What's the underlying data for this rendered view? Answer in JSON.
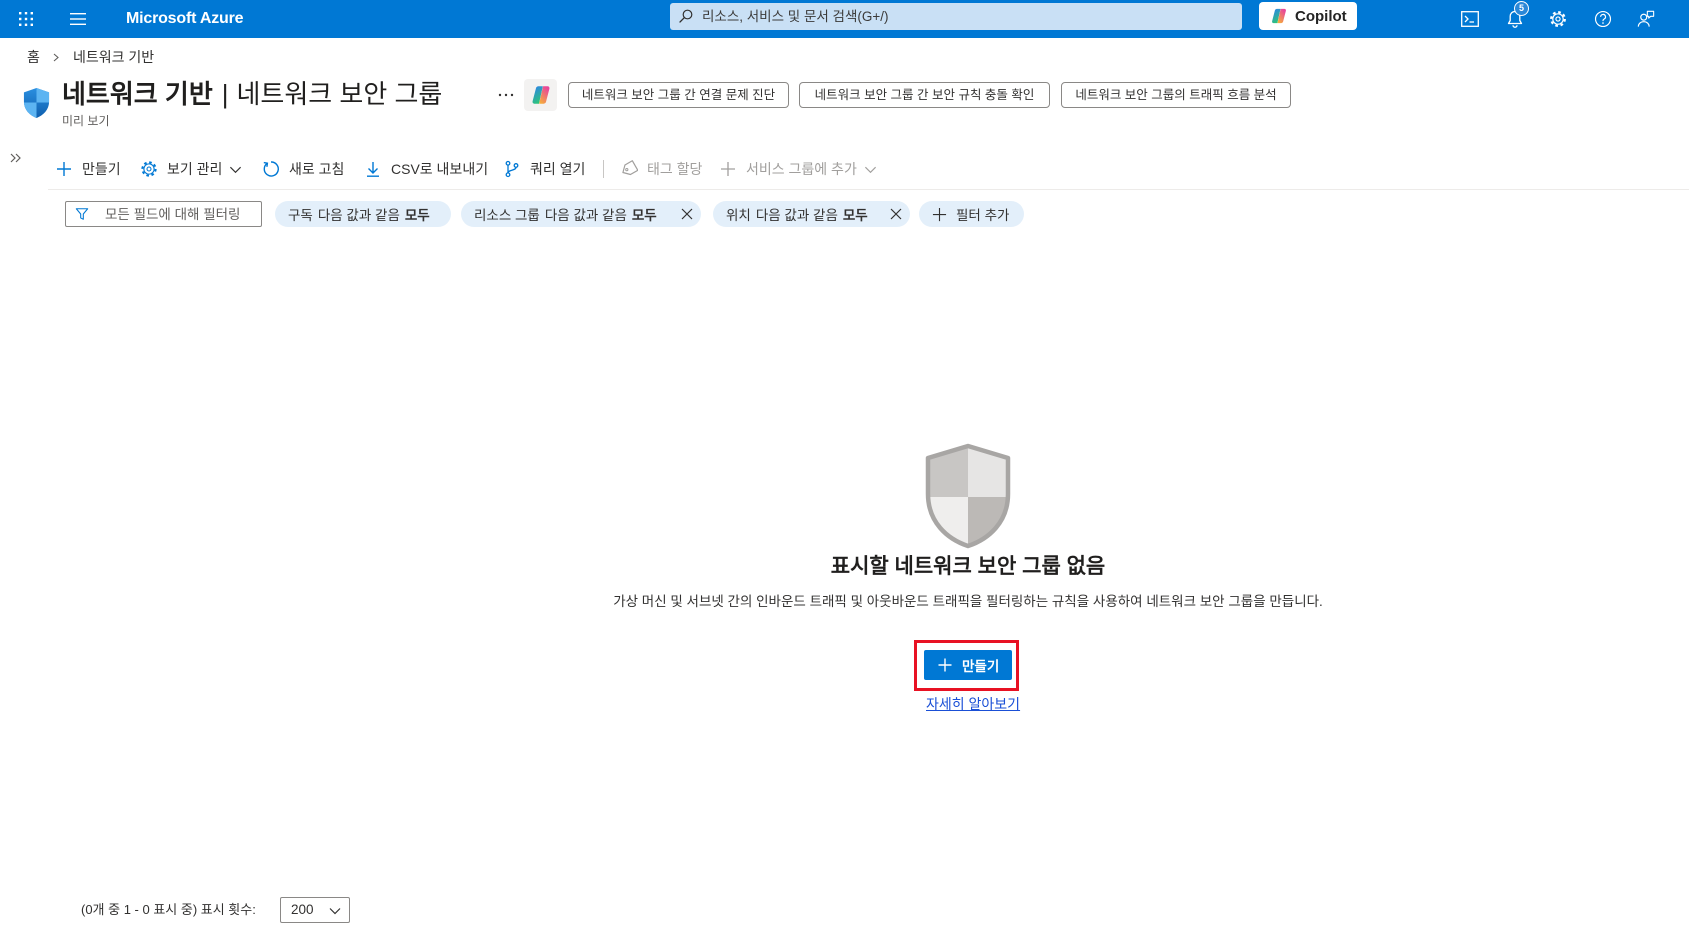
{
  "theme": {
    "accent_color": "#0078d4",
    "highlight_color": "#e81123"
  },
  "topbar": {
    "brand": "Microsoft Azure",
    "search_placeholder": "리소스, 서비스 및 문서 검색(G+/)",
    "copilot_label": "Copilot",
    "notification_count": "5",
    "icons": {
      "waffle": "waffle-icon",
      "menu": "hamburger-menu-icon",
      "search": "search-icon",
      "copilot": "copilot-icon",
      "cloud_shell": "cloud-shell-icon",
      "notifications": "bell-icon",
      "settings": "gear-icon",
      "help": "help-icon",
      "feedback": "feedback-icon"
    }
  },
  "breadcrumb": {
    "home": "홈",
    "current": "네트워크 기반"
  },
  "header": {
    "service": "네트워크 기반",
    "separator": "|",
    "page": "네트워크 보안 그룹",
    "preview_label": "미리 보기",
    "suggestions": [
      "네트워크 보안 그룹 간 연결 문제 진단",
      "네트워크 보안 그룹 간 보안 규칙 충돌 확인",
      "네트워크 보안 그룹의 트래픽 흐름 분석"
    ]
  },
  "toolbar": {
    "create": "만들기",
    "manage_view": "보기 관리",
    "refresh": "새로 고침",
    "export_csv": "CSV로 내보내기",
    "open_query": "쿼리 열기",
    "assign_tags": "태그 할당",
    "add_to_service_group": "서비스 그룹에 추가"
  },
  "filters": {
    "search_placeholder": "모든 필드에 대해 필터링",
    "pills": [
      {
        "field": "구독",
        "operator": "다음 값과 같음",
        "value": "모두",
        "removable": false
      },
      {
        "field": "리소스 그룹",
        "operator": "다음 값과 같음",
        "value": "모두",
        "removable": true
      },
      {
        "field": "위치",
        "operator": "다음 값과 같음",
        "value": "모두",
        "removable": true
      }
    ],
    "add_filter": "필터 추가"
  },
  "empty_state": {
    "title": "표시할 네트워크 보안 그룹 없음",
    "description": "가상 머신 및 서브넷 간의 인바운드 트래픽 및 아웃바운드 트래픽을 필터링하는 규칙을 사용하여 네트워크 보안 그룹을 만듭니다.",
    "create": "만들기",
    "learn_more": "자세히 알아보기"
  },
  "pagination": {
    "summary": "(0개 중 1 - 0 표시 중) 표시 횟수:",
    "page_size": "200"
  }
}
